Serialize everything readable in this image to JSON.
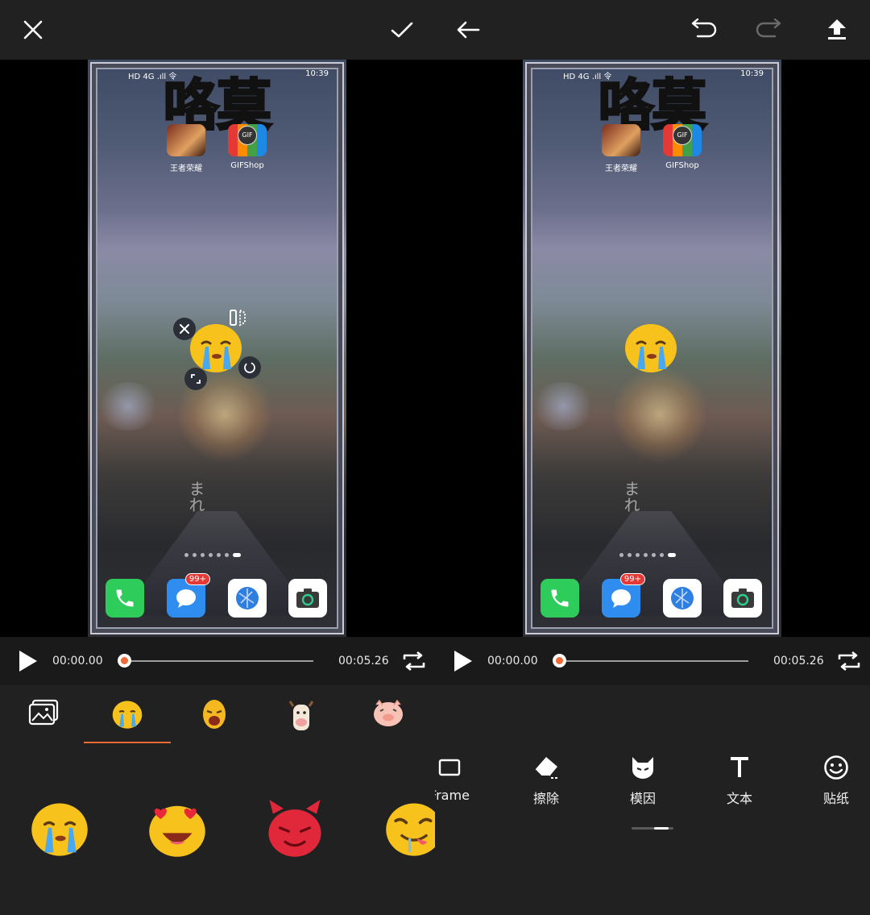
{
  "left_panel": {
    "toolbar": {
      "close_icon": "close-icon",
      "confirm_icon": "check-icon"
    },
    "stickers_tabs": [
      "gallery-icon",
      "crying-face-sticker",
      "screaming-face-sticker",
      "cow-sticker",
      "pig-sticker"
    ],
    "sticker_grid": [
      "crying-face-sticker",
      "heart-eyes-sticker",
      "devil-sticker",
      "yummy-face-sticker"
    ]
  },
  "right_panel": {
    "toolbar": {
      "back_icon": "arrow-left-icon",
      "undo_icon": "undo-icon",
      "redo_icon": "redo-icon",
      "export_icon": "upload-icon"
    },
    "tools": [
      {
        "label": "Frame",
        "icon": "frame-icon"
      },
      {
        "label": "擦除",
        "icon": "eraser-icon"
      },
      {
        "label": "模因",
        "icon": "devil-mask-icon"
      },
      {
        "label": "文本",
        "icon": "text-icon"
      },
      {
        "label": "贴纸",
        "icon": "smiley-icon"
      }
    ]
  },
  "preview": {
    "overlay_text": "咯莫",
    "status_time": "10:39",
    "status_left": "HD 4G .ıll 令",
    "apps": [
      {
        "label": "王者荣耀",
        "icon": "game-app-icon"
      },
      {
        "label": "GIFShop",
        "icon": "gifshop-app-icon",
        "badge": "GIF"
      }
    ],
    "dock": [
      {
        "icon": "phone-app-icon"
      },
      {
        "icon": "messages-app-icon",
        "badge": "99+"
      },
      {
        "icon": "browser-app-icon"
      },
      {
        "icon": "camera-app-icon"
      }
    ],
    "page_dots": 7,
    "active_dot": 7,
    "bg_text": "まれ"
  },
  "playback": {
    "current_time": "00:00.00",
    "total_time": "00:05.26",
    "progress": 0.0
  },
  "colors": {
    "accent": "#f06a35",
    "toolbar_bg": "#212121",
    "playbar_bg": "#1a1a1a"
  }
}
